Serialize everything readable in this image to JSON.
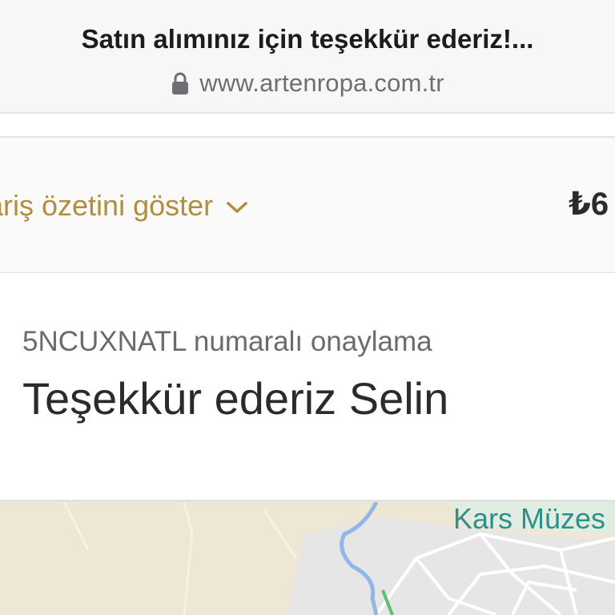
{
  "browser": {
    "page_title": "Satın alımınız için teşekkür ederiz!...",
    "url": "www.artenropa.com.tr",
    "lock_icon": "lock-icon"
  },
  "order_summary": {
    "toggle_label": "ariş özetini göster",
    "chevron_icon": "chevron-down-icon",
    "price": "₺6",
    "accent_color": "#b08e3e"
  },
  "confirmation": {
    "number_line": "5NCUXNATL numaralı onaylama",
    "thanks_line": "Teşekkür ederiz Selin"
  },
  "map": {
    "place_label": "Kars Müzes"
  }
}
